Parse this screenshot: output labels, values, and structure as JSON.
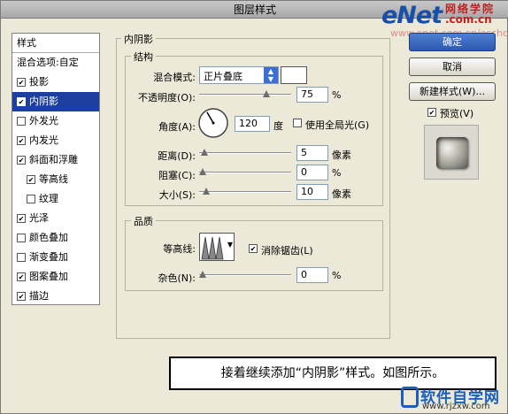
{
  "window": {
    "title": "图层样式"
  },
  "watermark": {
    "enet": "eNet",
    "cn": "网络学院",
    "domain": ".com.cn",
    "url": "www.enet.com.cn/eschool"
  },
  "sidebar": {
    "header": "样式",
    "blend_options": "混合选项:自定",
    "items": [
      {
        "label": "投影",
        "checked": true
      },
      {
        "label": "内阴影",
        "checked": true,
        "selected": true
      },
      {
        "label": "外发光",
        "checked": false
      },
      {
        "label": "内发光",
        "checked": true
      },
      {
        "label": "斜面和浮雕",
        "checked": true
      },
      {
        "label": "等高线",
        "checked": true,
        "indent": true
      },
      {
        "label": "纹理",
        "checked": false,
        "indent": true
      },
      {
        "label": "光泽",
        "checked": true
      },
      {
        "label": "颜色叠加",
        "checked": false
      },
      {
        "label": "渐变叠加",
        "checked": false
      },
      {
        "label": "图案叠加",
        "checked": true
      },
      {
        "label": "描边",
        "checked": true
      }
    ]
  },
  "inner_shadow": {
    "title": "内阴影",
    "structure": {
      "title": "结构",
      "blend_mode_label": "混合模式:",
      "blend_mode_value": "正片叠底",
      "opacity_label": "不透明度(O):",
      "opacity_value": "75",
      "opacity_unit": "%",
      "opacity_fraction": 0.75,
      "angle_label": "角度(A):",
      "angle_value": "120",
      "angle_unit": "度",
      "global_light_label": "使用全局光(G)",
      "global_light_checked": false,
      "distance_label": "距离(D):",
      "distance_value": "5",
      "distance_unit": "像素",
      "choke_label": "阻塞(C):",
      "choke_value": "0",
      "choke_unit": "%",
      "size_label": "大小(S):",
      "size_value": "10",
      "size_unit": "像素"
    },
    "quality": {
      "title": "品质",
      "contour_label": "等高线:",
      "anti_alias_label": "消除锯齿(L)",
      "anti_alias_checked": true,
      "noise_label": "杂色(N):",
      "noise_value": "0",
      "noise_unit": "%"
    }
  },
  "buttons": {
    "ok": "确定",
    "cancel": "取消",
    "new_style": "新建样式(W)...",
    "preview_label": "预览(V)",
    "preview_checked": true
  },
  "caption": "接着继续添加“内阴影”样式。如图所示。",
  "logo": {
    "main": "软件自学网",
    "sub": "www.rjzxw.com"
  },
  "colors": {
    "selection": "#1c3fa0",
    "ok_button": "#2b59b2",
    "dialog_bg": "#ece9d8"
  }
}
